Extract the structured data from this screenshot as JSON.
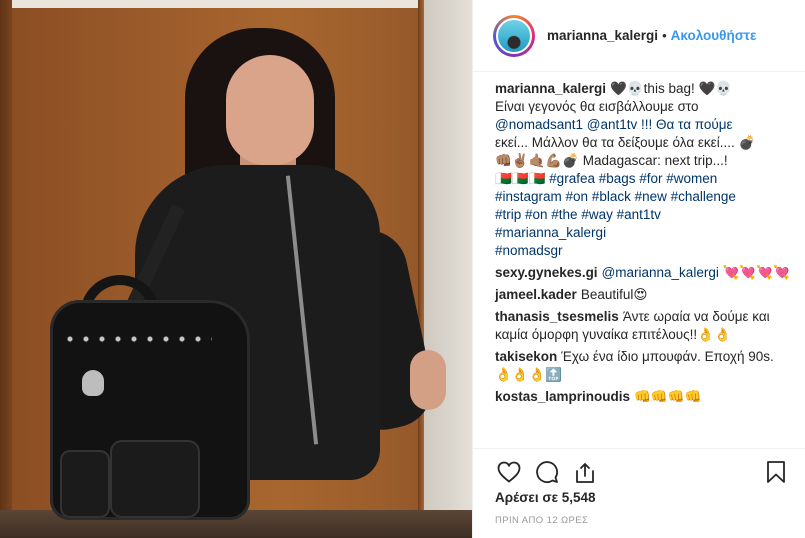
{
  "header": {
    "username": "marianna_kalergi",
    "separator": "•",
    "follow_label": "Ακολουθήστε"
  },
  "caption": {
    "username": "marianna_kalergi",
    "lines": [
      "🖤💀this bag! 🖤💀",
      "Είναι γεγονός θα εισβάλλουμε στο",
      "@nomadsant1 @ant1tv !!! Θα τα πούμε",
      "εκεί... Μάλλον θα τα δείξουμε όλα εκεί.... 💣",
      "👊🏽✌🏽🤙🏽💪🏽💣 Madagascar: next trip...!",
      "🇲🇬🇲🇬🇲🇬 #grafea #bags #for #women",
      "#instagram #on #black #new #challenge",
      "#trip #on #the #way #ant1tv",
      "#marianna_kalergi",
      "#nomadsgr"
    ]
  },
  "comments": [
    {
      "username": "sexy.gynekes.gi",
      "text": "@marianna_kalergi 💘💘💘💘"
    },
    {
      "username": "jameel.kader",
      "text": "Beautiful😍"
    },
    {
      "username": "thanasis_tsesmelis",
      "text": "Άντε ωραία να δούμε και καμία όμορφη γυναίκα επιτέλους!!👌👌"
    },
    {
      "username": "takisekon",
      "text": "Έχω ένα ίδιο μπουφάν. Εποχή 90s. 👌👌👌🔝"
    },
    {
      "username": "kostas_lamprinoudis",
      "text": "👊👊👊👊"
    }
  ],
  "actions": {
    "like_icon": "heart-icon",
    "comment_icon": "speech-bubble-icon",
    "share_icon": "share-icon",
    "save_icon": "bookmark-icon"
  },
  "likes_label": "Αρέσει σε 5,548",
  "time_label": "ΠΡΙΝ ΑΠΟ 12 ΩΡΕΣ",
  "colors": {
    "link": "#003569",
    "follow": "#3897f0",
    "text": "#262626",
    "muted": "#999999"
  }
}
